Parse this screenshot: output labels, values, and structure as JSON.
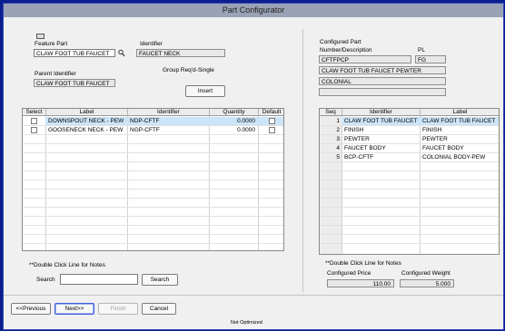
{
  "window": {
    "title": "Part Configurator"
  },
  "left": {
    "feature_part_label": "Feature Part",
    "feature_part_value": "CLAW FOOT TUB FAUCET",
    "identifier_label": "Identifier",
    "identifier_value": "FAUCET NECK",
    "parent_identifier_label": "Parent Identifier",
    "parent_identifier_value": "CLAW FOOT TUB FAUCET",
    "group_text": "Group Req'd-Single",
    "insert_label": "Insert",
    "table": {
      "headers": [
        "Select",
        "Label",
        "Identifier",
        "Quantity",
        "Default"
      ],
      "rows": [
        {
          "label": "DOWNSPOUT NECK - PEW",
          "identifier": "NDP-CFTF",
          "quantity": "0.0000"
        },
        {
          "label": "GOOSENECK NECK - PEW",
          "identifier": "NGP-CFTF",
          "quantity": "0.0000"
        }
      ]
    },
    "notes_hint": "**Double Click Line for Notes",
    "search_label": "Search",
    "search_value": "",
    "search_button": "Search"
  },
  "right": {
    "configured_part_label": "Configured Part",
    "number_desc_label": "Number/Description",
    "pl_label": "PL",
    "part_number": "CFTFPCP",
    "pl_value": "FG",
    "description_line1": "CLAW FOOT TUB FAUCET PEWTER",
    "description_line2": "COLONIAL",
    "description_line3": "",
    "table": {
      "headers": [
        "Seq",
        "Identifier",
        "Label"
      ],
      "rows": [
        {
          "seq": "1",
          "identifier": "CLAW FOOT TUB FAUCET",
          "label": "CLAW FOOT TUB FAUCET"
        },
        {
          "seq": "2",
          "identifier": "FINISH",
          "label": "FINISH"
        },
        {
          "seq": "3",
          "identifier": "PEWTER",
          "label": "PEWTER"
        },
        {
          "seq": "4",
          "identifier": "FAUCET BODY",
          "label": "FAUCET BODY"
        },
        {
          "seq": "5",
          "identifier": "BCP-CFTF",
          "label": "COLONIAL BODY-PEW"
        }
      ]
    },
    "notes_hint": "**Double Click Line for Notes",
    "price_label": "Configured Price",
    "price_value": "110.00",
    "weight_label": "Configured Weight",
    "weight_value": "5.000"
  },
  "footer": {
    "previous": "<<Previous",
    "next": "Next>>",
    "finish": "Finish",
    "cancel": "Cancel",
    "status": "Not Optimized"
  },
  "colors": {
    "background": "#0b1e8f",
    "titlebar": "#9aa3b5",
    "selected_row": "#cce4f7"
  }
}
